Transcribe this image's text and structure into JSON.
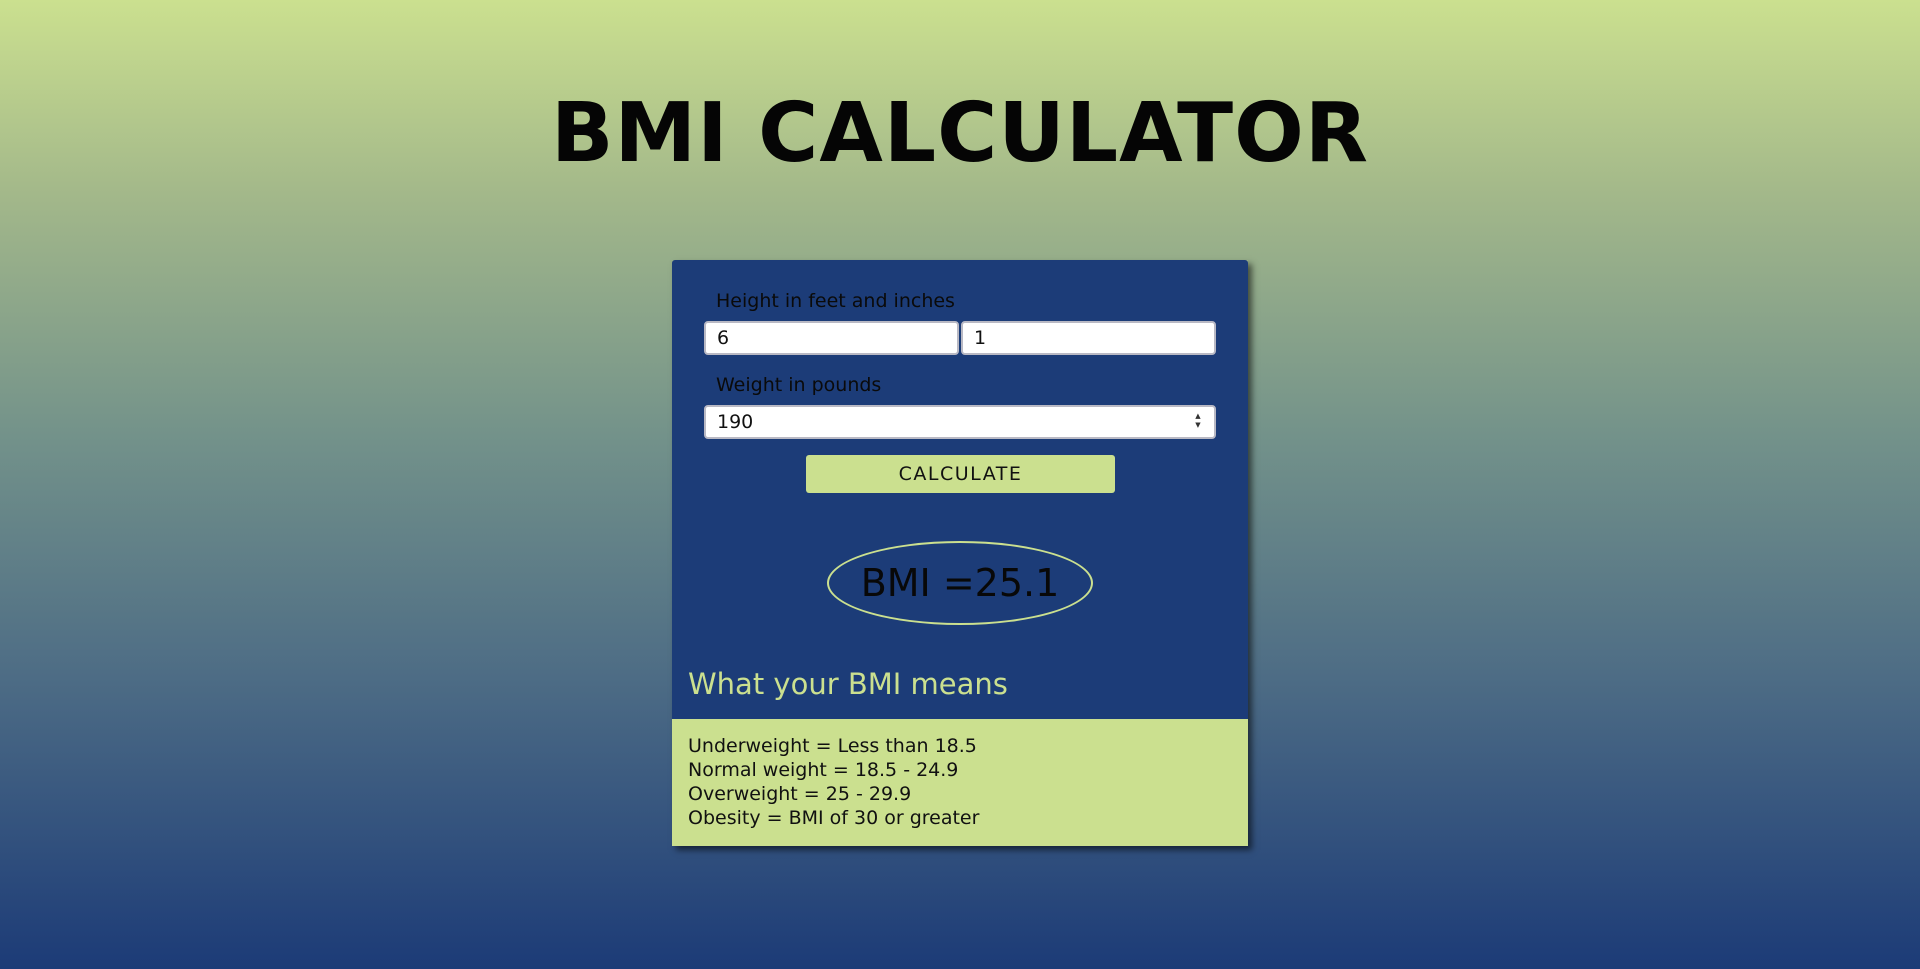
{
  "page": {
    "title": "BMI CALCULATOR"
  },
  "form": {
    "height_label": "Height in feet and inches",
    "feet_value": "6",
    "inches_value": "1",
    "weight_label": "Weight in pounds",
    "weight_value": "190",
    "calculate_label": "CALCULATE"
  },
  "result": {
    "text": "BMI =25.1"
  },
  "meaning": {
    "heading": "What your BMI means",
    "ranges": [
      "Underweight = Less than 18.5",
      "Normal weight = 18.5 - 24.9",
      "Overweight = 25 - 29.9",
      "Obesity = BMI of 30 or greater"
    ]
  },
  "colors": {
    "accent": "#cbe08f",
    "card": "#1c3c78",
    "background_top": "#cbe08f",
    "background_bottom": "#1c3b77"
  },
  "icons": {
    "spinner": "up-down-spinner-icon"
  }
}
